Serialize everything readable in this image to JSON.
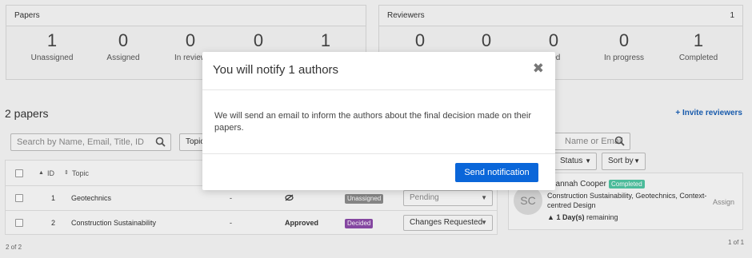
{
  "papers_panel": {
    "title": "Papers",
    "stats": [
      {
        "value": "1",
        "label": "Unassigned"
      },
      {
        "value": "0",
        "label": "Assigned"
      },
      {
        "value": "0",
        "label": "In review"
      },
      {
        "value": "0",
        "label": ""
      },
      {
        "value": "1",
        "label": ""
      }
    ]
  },
  "reviewers_panel": {
    "title": "Reviewers",
    "count": "1",
    "stats": [
      {
        "value": "0",
        "label": ""
      },
      {
        "value": "0",
        "label": ""
      },
      {
        "value": "0",
        "label": "ned"
      },
      {
        "value": "0",
        "label": "In progress"
      },
      {
        "value": "1",
        "label": "Completed"
      }
    ]
  },
  "papers_list": {
    "title": "2 papers",
    "search_placeholder": "Search by Name, Email, Title, ID",
    "topic_filter": "Topic",
    "columns": {
      "id": "ID",
      "topic": "Topic"
    },
    "rows": [
      {
        "id": "1",
        "topic": "Geotechnics",
        "dash": "-",
        "decision": "",
        "badge": "Unassigned",
        "status": "Pending"
      },
      {
        "id": "2",
        "topic": "Construction Sustainability",
        "dash": "-",
        "decision": "Approved",
        "badge": "Decided",
        "status": "Changes Requested"
      }
    ],
    "footer": "2 of 2"
  },
  "reviewers_list": {
    "invite_label": "+ Invite reviewers",
    "search_placeholder": "Name or Email",
    "status_filter": "Status",
    "sort_filter": "Sort by",
    "reviewer": {
      "initials": "SC",
      "name": "usannah Cooper",
      "badge": "Completed",
      "topics": "Construction Sustainability, Geotechnics, Context-centred Design",
      "remaining": "1 Day(s)",
      "remaining_suffix": " remaining",
      "assign_label": "Assign"
    },
    "footer": "1 of 1"
  },
  "modal": {
    "title": "You will notify 1 authors",
    "body": "We will send an email to inform the authors about the final decision made on their papers.",
    "send_label": "Send notification"
  },
  "icons": {
    "close": "close-icon",
    "search": "search-icon",
    "warning": "warning-icon",
    "hidden": "eye-slash-icon"
  },
  "colors": {
    "primary": "#0a66d9",
    "badge_unassigned": "#8a8a8a",
    "badge_decided": "#8b4aa8",
    "badge_completed": "#4fc3a1",
    "link": "#1a5fb4"
  }
}
